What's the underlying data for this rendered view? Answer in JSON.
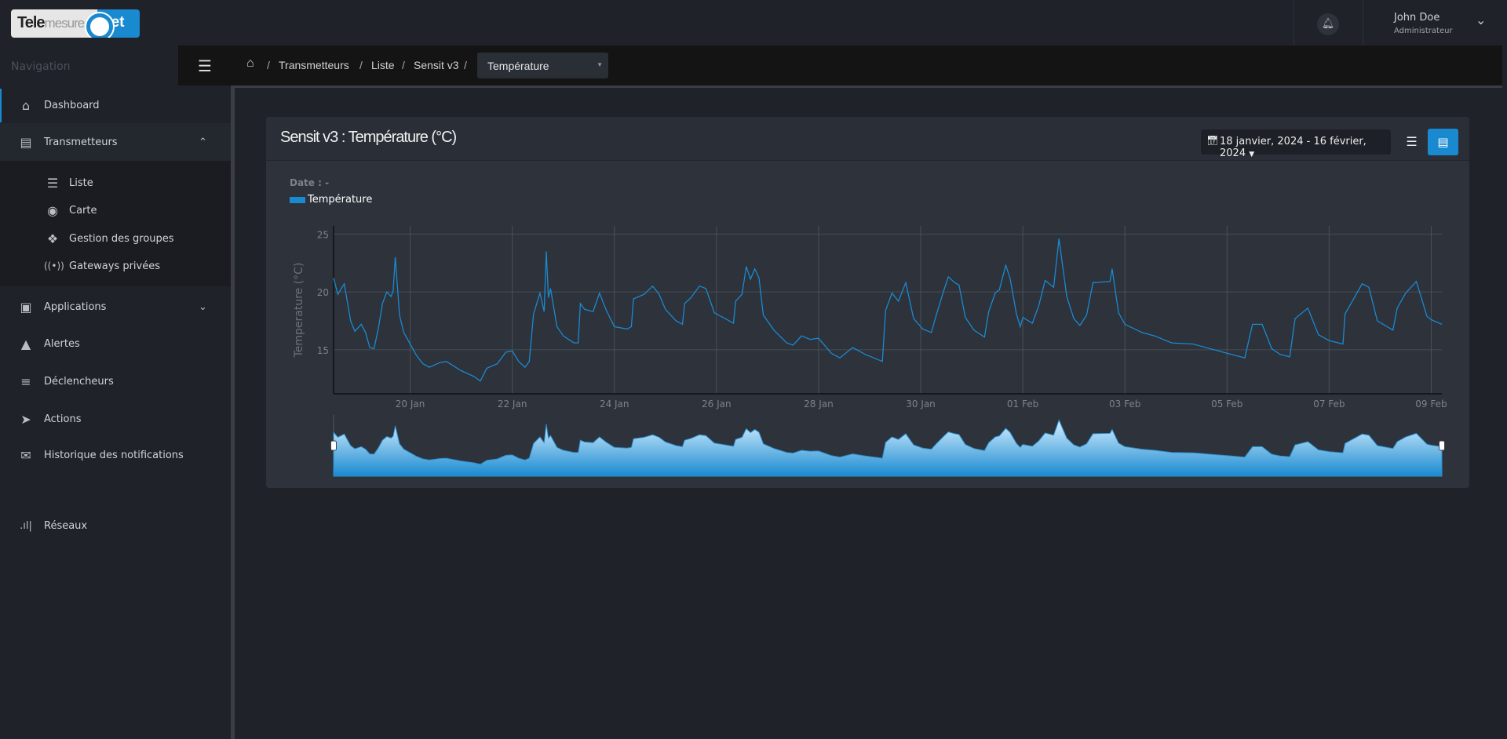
{
  "header": {
    "logo_text": "Telemesure.net",
    "user_name": "John Doe",
    "user_role": "Administrateur",
    "icons": {
      "bell": "bell-icon",
      "user_menu": "chevron-down-icon"
    }
  },
  "sidebar": {
    "label": "Navigation",
    "items": [
      {
        "label": "Dashboard",
        "icon": "home-icon"
      },
      {
        "label": "Transmetteurs",
        "icon": "server-icon",
        "expanded": true,
        "children": [
          {
            "label": "Liste",
            "icon": "list-icon"
          },
          {
            "label": "Carte",
            "icon": "map-marker-icon"
          },
          {
            "label": "Gestion des groupes",
            "icon": "tags-icon"
          },
          {
            "label": "Gateways privées",
            "icon": "antenna-icon"
          }
        ]
      },
      {
        "label": "Applications",
        "icon": "cubes-icon",
        "expanded": false
      },
      {
        "label": "Alertes",
        "icon": "bell-icon"
      },
      {
        "label": "Déclencheurs",
        "icon": "sliders-icon"
      },
      {
        "label": "Actions",
        "icon": "rocket-icon"
      },
      {
        "label": "Historique des notifications",
        "icon": "envelope-icon"
      },
      {
        "label": "Réseaux",
        "icon": "signal-icon"
      }
    ]
  },
  "breadcrumb": {
    "items": [
      "Transmetteurs",
      "Liste",
      "Sensit v3"
    ],
    "separator": "/",
    "select_value": "Température"
  },
  "card": {
    "title": "Sensit v3 : Température (°C)",
    "date_range": "18 janvier, 2024 - 16 février, 2024",
    "date_label": "Date : -"
  },
  "colors": {
    "accent": "#1a8ad0",
    "background": "#1f2229",
    "card": "#2d323b"
  },
  "chart_data": {
    "type": "line",
    "ylabel": "Temperature (°C)",
    "legend": [
      "Température"
    ],
    "legend_placement": "top-left",
    "grid": true,
    "ylim": [
      11.2,
      25.7
    ],
    "yticks": [
      15,
      20,
      25
    ],
    "xlim": [
      "2024-01-18 12:00",
      "2024-02-09 05:00"
    ],
    "xticks": [
      {
        "date": "2024-01-20",
        "label": "20 Jan"
      },
      {
        "date": "2024-01-22",
        "label": "22 Jan"
      },
      {
        "date": "2024-01-24",
        "label": "24 Jan"
      },
      {
        "date": "2024-01-26",
        "label": "26 Jan"
      },
      {
        "date": "2024-01-28",
        "label": "28 Jan"
      },
      {
        "date": "2024-01-30",
        "label": "30 Jan"
      },
      {
        "date": "2024-02-01",
        "label": "01 Feb"
      },
      {
        "date": "2024-02-03",
        "label": "03 Feb"
      },
      {
        "date": "2024-02-05",
        "label": "05 Feb"
      },
      {
        "date": "2024-02-07",
        "label": "07 Feb"
      },
      {
        "date": "2024-02-09",
        "label": "09 Feb"
      }
    ],
    "navigator": true,
    "series": [
      {
        "name": "Température",
        "color": "#1a8ad0",
        "points": [
          [
            "2024-01-18 12:00",
            21.2
          ],
          [
            "2024-01-18 14:00",
            19.8
          ],
          [
            "2024-01-18 17:00",
            20.7
          ],
          [
            "2024-01-18 20:00",
            17.5
          ],
          [
            "2024-01-18 22:00",
            16.6
          ],
          [
            "2024-01-19 01:00",
            17.2
          ],
          [
            "2024-01-19 03:00",
            16.5
          ],
          [
            "2024-01-19 05:00",
            15.2
          ],
          [
            "2024-01-19 07:00",
            15.1
          ],
          [
            "2024-01-19 09:00",
            16.8
          ],
          [
            "2024-01-19 11:00",
            19.0
          ],
          [
            "2024-01-19 13:00",
            20.0
          ],
          [
            "2024-01-19 15:00",
            19.6
          ],
          [
            "2024-01-19 16:00",
            20.1
          ],
          [
            "2024-01-19 17:00",
            23.0
          ],
          [
            "2024-01-19 19:00",
            18.0
          ],
          [
            "2024-01-19 21:00",
            16.5
          ],
          [
            "2024-01-20 00:00",
            15.5
          ],
          [
            "2024-01-20 03:00",
            14.5
          ],
          [
            "2024-01-20 06:00",
            13.8
          ],
          [
            "2024-01-20 09:00",
            13.5
          ],
          [
            "2024-01-20 14:00",
            13.9
          ],
          [
            "2024-01-20 17:00",
            14.0
          ],
          [
            "2024-01-21 00:00",
            13.2
          ],
          [
            "2024-01-21 06:00",
            12.7
          ],
          [
            "2024-01-21 09:00",
            12.3
          ],
          [
            "2024-01-21 12:00",
            13.4
          ],
          [
            "2024-01-21 17:00",
            13.8
          ],
          [
            "2024-01-21 21:00",
            14.8
          ],
          [
            "2024-01-22 00:00",
            14.9
          ],
          [
            "2024-01-22 03:00",
            14.0
          ],
          [
            "2024-01-22 06:00",
            13.5
          ],
          [
            "2024-01-22 08:00",
            14.0
          ],
          [
            "2024-01-22 10:00",
            18.1
          ],
          [
            "2024-01-22 13:00",
            19.9
          ],
          [
            "2024-01-22 15:00",
            18.3
          ],
          [
            "2024-01-22 16:00",
            23.5
          ],
          [
            "2024-01-22 17:00",
            19.5
          ],
          [
            "2024-01-22 18:00",
            20.3
          ],
          [
            "2024-01-22 21:00",
            17.0
          ],
          [
            "2024-01-23 00:00",
            16.2
          ],
          [
            "2024-01-23 05:00",
            15.6
          ],
          [
            "2024-01-23 07:00",
            15.6
          ],
          [
            "2024-01-23 08:00",
            19.0
          ],
          [
            "2024-01-23 10:00",
            18.5
          ],
          [
            "2024-01-23 14:00",
            18.3
          ],
          [
            "2024-01-23 17:00",
            19.9
          ],
          [
            "2024-01-23 20:00",
            18.5
          ],
          [
            "2024-01-24 00:00",
            17.0
          ],
          [
            "2024-01-24 06:00",
            16.8
          ],
          [
            "2024-01-24 08:00",
            17.0
          ],
          [
            "2024-01-24 09:00",
            19.4
          ],
          [
            "2024-01-24 14:00",
            19.8
          ],
          [
            "2024-01-24 18:00",
            20.5
          ],
          [
            "2024-01-24 21:00",
            19.8
          ],
          [
            "2024-01-25 00:00",
            18.5
          ],
          [
            "2024-01-25 05:00",
            17.5
          ],
          [
            "2024-01-25 08:00",
            17.2
          ],
          [
            "2024-01-25 09:00",
            19.0
          ],
          [
            "2024-01-25 12:00",
            19.5
          ],
          [
            "2024-01-25 16:00",
            20.5
          ],
          [
            "2024-01-25 19:00",
            20.3
          ],
          [
            "2024-01-25 23:00",
            18.2
          ],
          [
            "2024-01-26 03:00",
            17.8
          ],
          [
            "2024-01-26 08:00",
            17.3
          ],
          [
            "2024-01-26 09:00",
            19.2
          ],
          [
            "2024-01-26 12:00",
            19.8
          ],
          [
            "2024-01-26 14:00",
            22.2
          ],
          [
            "2024-01-26 16:00",
            21.1
          ],
          [
            "2024-01-26 18:00",
            22.0
          ],
          [
            "2024-01-26 20:00",
            21.2
          ],
          [
            "2024-01-26 22:00",
            18.0
          ],
          [
            "2024-01-27 03:00",
            16.7
          ],
          [
            "2024-01-27 09:00",
            15.6
          ],
          [
            "2024-01-27 12:00",
            15.4
          ],
          [
            "2024-01-27 16:00",
            16.2
          ],
          [
            "2024-01-27 20:00",
            15.9
          ],
          [
            "2024-01-28 00:00",
            16.0
          ],
          [
            "2024-01-28 06:00",
            14.7
          ],
          [
            "2024-01-28 10:00",
            14.3
          ],
          [
            "2024-01-28 16:00",
            15.2
          ],
          [
            "2024-01-28 22:00",
            14.6
          ],
          [
            "2024-01-29 06:00",
            14.0
          ],
          [
            "2024-01-29 07:30",
            18.4
          ],
          [
            "2024-01-29 10:30",
            19.9
          ],
          [
            "2024-01-29 13:30",
            19.2
          ],
          [
            "2024-01-29 17:00",
            20.8
          ],
          [
            "2024-01-29 20:40",
            17.7
          ],
          [
            "2024-01-30 01:00",
            16.8
          ],
          [
            "2024-01-30 05:00",
            16.5
          ],
          [
            "2024-01-30 07:20",
            18.0
          ],
          [
            "2024-01-30 11:00",
            20.2
          ],
          [
            "2024-01-30 13:00",
            21.3
          ],
          [
            "2024-01-30 16:00",
            20.8
          ],
          [
            "2024-01-30 18:00",
            20.6
          ],
          [
            "2024-01-30 21:00",
            17.8
          ],
          [
            "2024-01-31 01:00",
            16.7
          ],
          [
            "2024-01-31 06:00",
            16.1
          ],
          [
            "2024-01-31 08:00",
            18.3
          ],
          [
            "2024-01-31 11:00",
            19.9
          ],
          [
            "2024-01-31 13:00",
            20.2
          ],
          [
            "2024-01-31 16:00",
            22.3
          ],
          [
            "2024-01-31 18:00",
            21.2
          ],
          [
            "2024-01-31 21:00",
            18.1
          ],
          [
            "2024-01-31 22:50",
            17.0
          ],
          [
            "2024-02-01 00:00",
            17.8
          ],
          [
            "2024-02-01 04:30",
            17.3
          ],
          [
            "2024-02-01 07:30",
            18.8
          ],
          [
            "2024-02-01 10:30",
            21.0
          ],
          [
            "2024-02-01 14:30",
            20.4
          ],
          [
            "2024-02-01 17:00",
            24.6
          ],
          [
            "2024-02-01 20:40",
            19.6
          ],
          [
            "2024-02-02 00:00",
            17.7
          ],
          [
            "2024-02-02 02:50",
            17.1
          ],
          [
            "2024-02-02 06:00",
            18.0
          ],
          [
            "2024-02-02 09:00",
            20.8
          ],
          [
            "2024-02-02 17:00",
            20.9
          ],
          [
            "2024-02-02 18:00",
            22.0
          ],
          [
            "2024-02-02 21:00",
            18.2
          ],
          [
            "2024-02-03 00:00",
            17.2
          ],
          [
            "2024-02-03 08:00",
            16.5
          ],
          [
            "2024-02-03 14:00",
            16.2
          ],
          [
            "2024-02-03 22:00",
            15.6
          ],
          [
            "2024-02-04 08:00",
            15.5
          ],
          [
            "2024-02-04 18:00",
            15.0
          ],
          [
            "2024-02-05 00:00",
            14.7
          ],
          [
            "2024-02-05 08:20",
            14.3
          ],
          [
            "2024-02-05 12:00",
            17.2
          ],
          [
            "2024-02-05 16:30",
            17.2
          ],
          [
            "2024-02-05 21:00",
            15.1
          ],
          [
            "2024-02-06 01:00",
            14.6
          ],
          [
            "2024-02-06 05:30",
            14.4
          ],
          [
            "2024-02-06 08:00",
            17.7
          ],
          [
            "2024-02-06 14:00",
            18.6
          ],
          [
            "2024-02-06 19:00",
            16.3
          ],
          [
            "2024-02-07 00:00",
            15.8
          ],
          [
            "2024-02-07 06:30",
            15.5
          ],
          [
            "2024-02-07 07:30",
            18.1
          ],
          [
            "2024-02-07 15:30",
            20.7
          ],
          [
            "2024-02-07 18:40",
            20.4
          ],
          [
            "2024-02-07 22:40",
            17.5
          ],
          [
            "2024-02-08 06:00",
            16.7
          ],
          [
            "2024-02-08 08:00",
            18.6
          ],
          [
            "2024-02-08 12:00",
            19.9
          ],
          [
            "2024-02-08 17:00",
            20.9
          ],
          [
            "2024-02-08 22:00",
            17.9
          ],
          [
            "2024-02-09 00:00",
            17.6
          ],
          [
            "2024-02-09 05:00",
            17.2
          ]
        ]
      }
    ]
  }
}
